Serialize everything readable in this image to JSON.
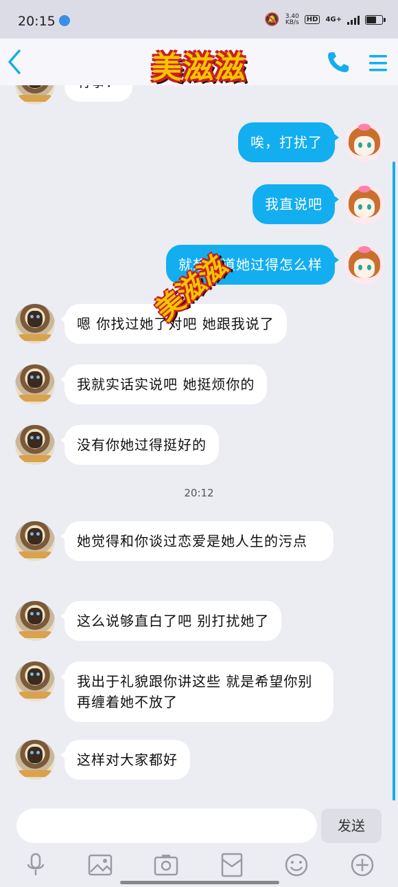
{
  "status_bar": {
    "time": "20:15",
    "speed": "3.40\nKB/s",
    "hd": "HD",
    "network": "4G+"
  },
  "header": {
    "title": "美滋滋",
    "back_icon": "chevron-left-icon",
    "phone_icon": "phone-icon",
    "menu_icon": "menu-icon",
    "accent": "#12aef0"
  },
  "messages": [
    {
      "side": "in",
      "text": "有事？"
    },
    {
      "side": "out",
      "text": "唉，打扰了"
    },
    {
      "side": "out",
      "text": "我直说吧"
    },
    {
      "side": "out",
      "text": "就想知道她过得怎么样"
    },
    {
      "side": "in",
      "text": "嗯 你找过她了对吧 她跟我说了"
    },
    {
      "side": "in",
      "text": "我就实话实说吧 她挺烦你的"
    },
    {
      "side": "in",
      "text": "没有你她过得挺好的"
    },
    {
      "side": "in",
      "text": "她觉得和你谈过恋爱是她人生的污点"
    },
    {
      "side": "in",
      "text": "这么说够直白了吧 别打扰她了"
    },
    {
      "side": "in",
      "text": "我出于礼貌跟你讲这些 就是希望你别再缠着她不放了"
    },
    {
      "side": "in",
      "text": "这样对大家都好"
    }
  ],
  "timestamp": "20:12",
  "watermark": "美滋滋",
  "input": {
    "placeholder": "",
    "send_label": "发送"
  },
  "toolbar": [
    "mic-icon",
    "image-icon",
    "camera-icon",
    "red-packet-icon",
    "emoji-icon",
    "plus-icon"
  ]
}
